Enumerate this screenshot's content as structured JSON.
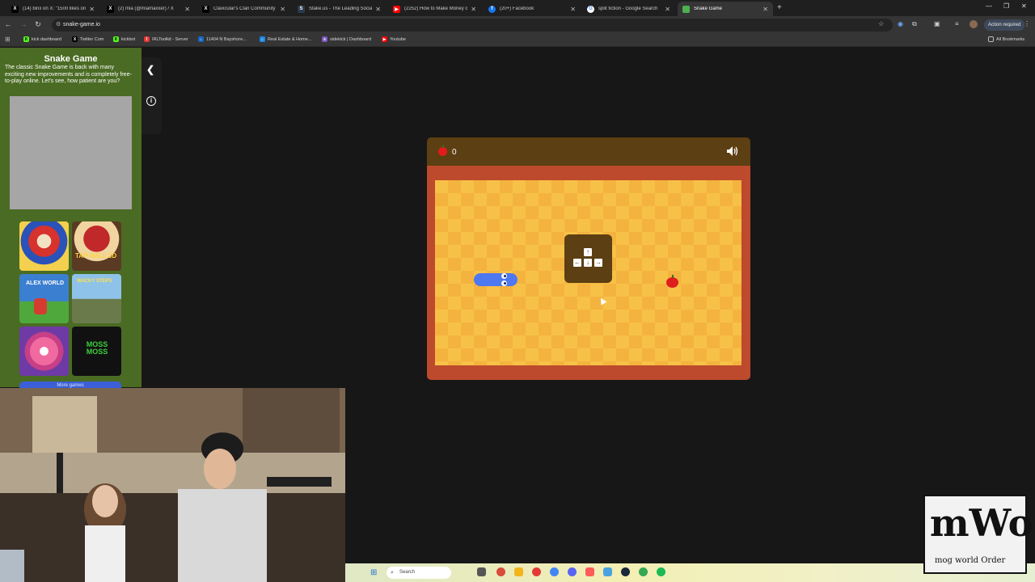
{
  "browser": {
    "tabs": [
      {
        "label": "(14) binx on X: \"1500 likes on a",
        "icon": "x-logo-icon",
        "fav_char": "X",
        "fav_color": "#000000"
      },
      {
        "label": "(2) mia (@miamaxxer) / X",
        "icon": "x-logo-icon",
        "fav_char": "X",
        "fav_color": "#000000"
      },
      {
        "label": "Clavicular's Clan Community / X",
        "icon": "x-logo-icon",
        "fav_char": "X",
        "fav_color": "#000000"
      },
      {
        "label": "Stake.us - The Leading Social C",
        "icon": "stake-icon",
        "fav_char": "S",
        "fav_color": "#2a3b4d"
      },
      {
        "label": "(2252) How to Make Money on",
        "icon": "youtube-icon",
        "fav_char": "▶",
        "fav_color": "#ff0000"
      },
      {
        "label": "(20+) Facebook",
        "icon": "facebook-icon",
        "fav_char": "f",
        "fav_color": "#1877f2"
      },
      {
        "label": "split fiction - Google Search",
        "icon": "google-icon",
        "fav_char": "G",
        "fav_color": "#ffffff"
      },
      {
        "label": "Snake Game",
        "icon": "snake-game-icon",
        "fav_char": "",
        "fav_color": "#4caf50"
      }
    ],
    "new_tab": "+",
    "address": "snake-game.io",
    "action_required": "Action required",
    "bookmarks": [
      {
        "label": "kick dashboard",
        "icon": "kick-icon",
        "color": "#53fc18"
      },
      {
        "label": "Twitter Com",
        "icon": "x-logo-icon",
        "color": "#000000"
      },
      {
        "label": "kickbot",
        "icon": "kickbot-icon",
        "color": "#53fc18"
      },
      {
        "label": "IRLToolkit - Server",
        "icon": "irltoolkit-icon",
        "color": "#e53935"
      },
      {
        "label": "11404 N Bayshore...",
        "icon": "house-icon",
        "color": "#1565c0"
      },
      {
        "label": "Real Estate & Home...",
        "icon": "realestate-icon",
        "color": "#1e88e5"
      },
      {
        "label": "sidekick | Dashboard",
        "icon": "sidekick-icon",
        "color": "#7e57c2"
      },
      {
        "label": "Youtube",
        "icon": "youtube-icon",
        "color": "#ff0000"
      }
    ],
    "all_bookmarks": "All Bookmarks"
  },
  "sidebar": {
    "title": "Snake Game",
    "description": "The classic Snake Game is back with many exciting new improvements and is completely free-to-play online. Let's see, how patient are you?",
    "games": [
      {
        "name": "game-thumb-amazing-digital-circus",
        "c1": "#d7322d",
        "c2": "#2a52b8"
      },
      {
        "name": "game-thumb-tap-ball-3d",
        "c1": "#c0282a",
        "c2": "#f0d5a0"
      },
      {
        "name": "game-thumb-alex-world",
        "c1": "#3b7fd1",
        "c2": "#f4c542"
      },
      {
        "name": "game-thumb-wacky-steps",
        "c1": "#8fc2e8",
        "c2": "#6b7a4b"
      },
      {
        "name": "game-thumb-helix-spiral",
        "c1": "#f06aa0",
        "c2": "#ffffff"
      },
      {
        "name": "game-thumb-moss-moss",
        "c1": "#111111",
        "c2": "#3ecf3e"
      }
    ],
    "moss_title": "MOSS MOSS",
    "tap_title": "TAP BALL 3D",
    "alex_title": "ALEX WORLD",
    "wacky_title": "WACKY STEPS",
    "more_games": "More games"
  },
  "game": {
    "score": "0",
    "colors": {
      "board_light": "#f7c147",
      "board_dark": "#f4b33f",
      "frame": "#bd4a2c",
      "topbar": "#5c3f12",
      "snake": "#4d78f0",
      "apple": "#df1d1d"
    },
    "keys": {
      "up": "↑",
      "left": "←",
      "down": "↓",
      "right": "→"
    }
  },
  "taskbar": {
    "search_placeholder": "Search"
  },
  "logo": {
    "text_main": "mWo",
    "text_sub": "mog world Order"
  }
}
